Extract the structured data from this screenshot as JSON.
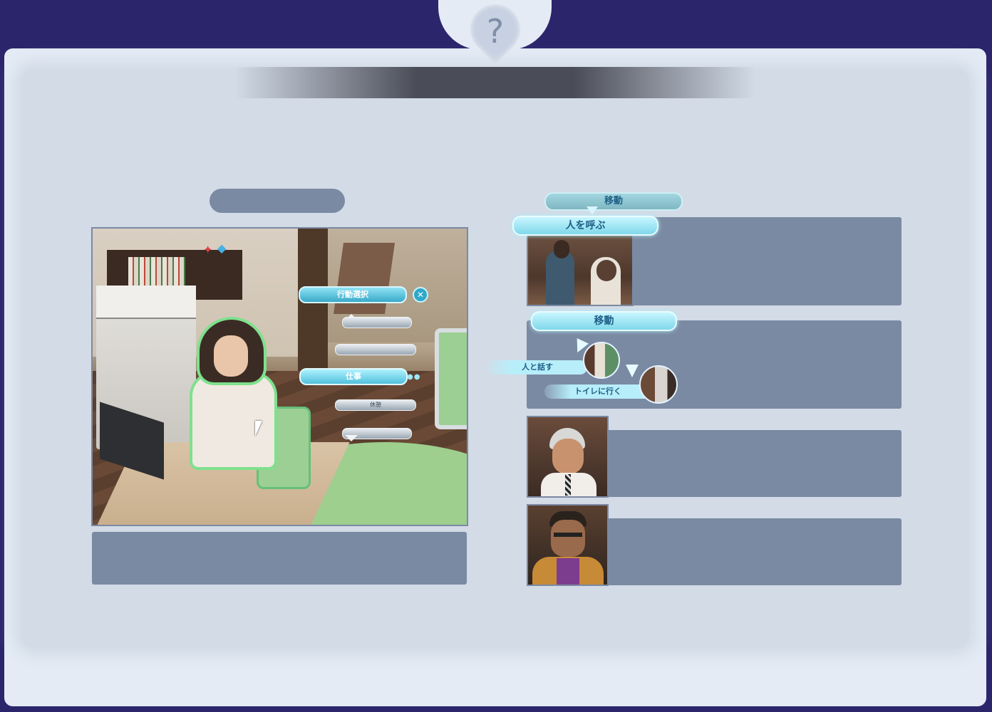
{
  "help": {
    "symbol": "?"
  },
  "scene": {
    "menu": {
      "title": "行動選択",
      "selected": "仕事",
      "small_item": "休憩",
      "close_symbol": "✕"
    }
  },
  "right": {
    "call_group": {
      "top_label": "移動",
      "main_label": "人を呼ぶ"
    },
    "move_group": {
      "main_label": "移動",
      "talk_label": "人と話す",
      "toilet_label": "トイレに行く"
    }
  },
  "colors": {
    "frame_bg": "#2b256c",
    "panel": "#e4ebf5",
    "inner": "#d2dbe6",
    "placeholder": "#7b8aa3",
    "accent": "#7fd8ea"
  }
}
